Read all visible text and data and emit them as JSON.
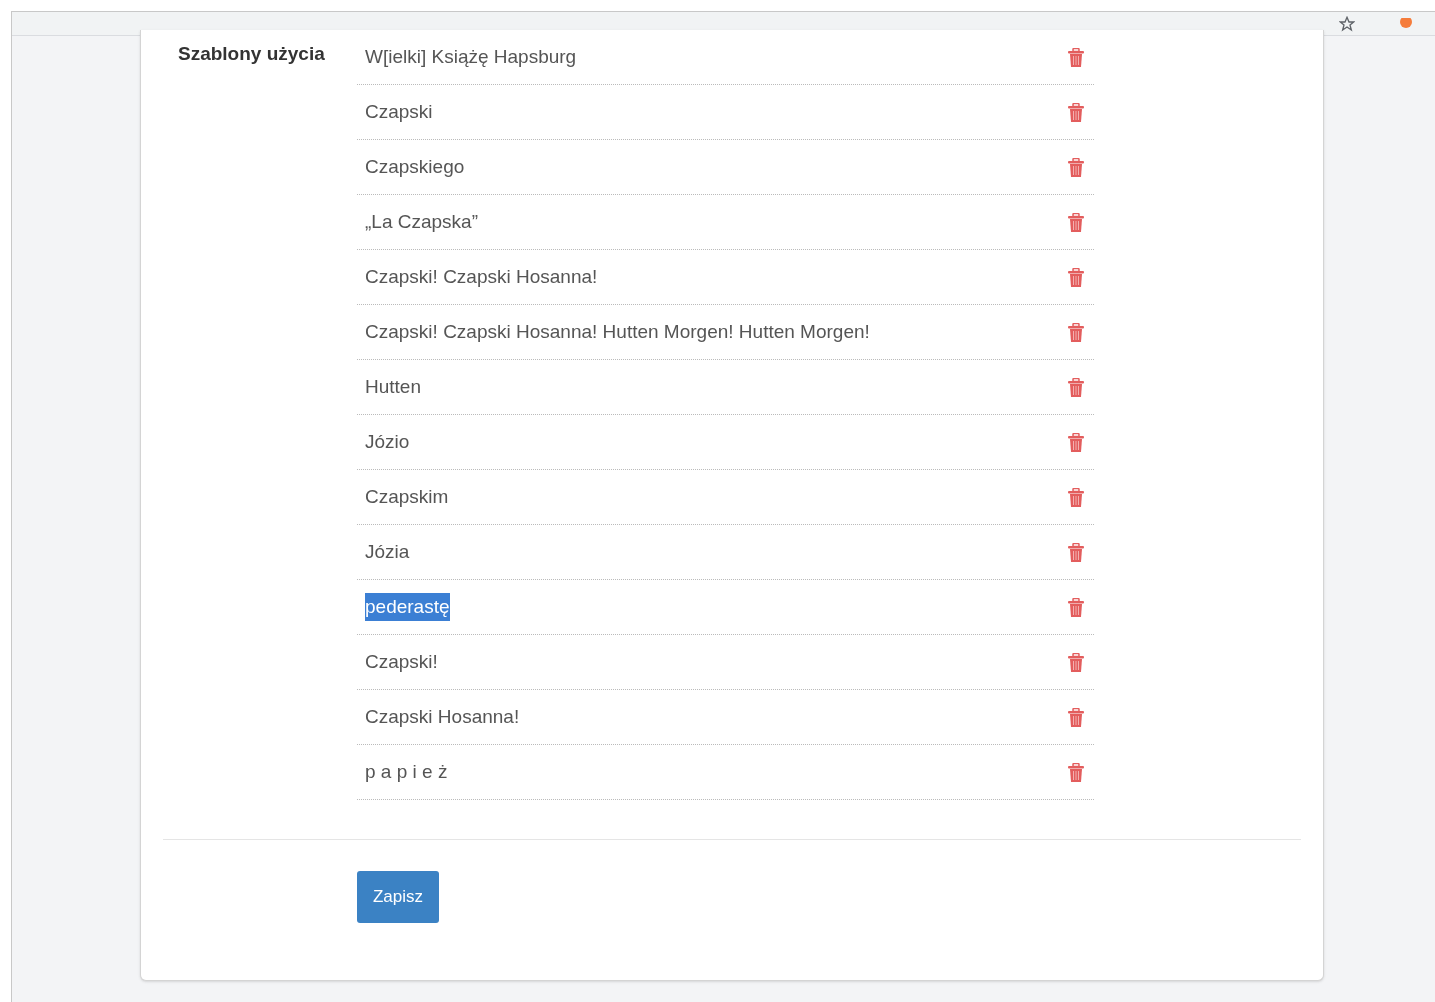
{
  "form": {
    "label": "Szablony użycia",
    "items": [
      {
        "text": "W[ielki] Książę Hapsburg",
        "selected": false
      },
      {
        "text": "Czapski",
        "selected": false
      },
      {
        "text": "Czapskiego",
        "selected": false
      },
      {
        "text": "„La Czapska”",
        "selected": false
      },
      {
        "text": "Czapski! Czapski Hosanna!",
        "selected": false
      },
      {
        "text": "Czapski! Czapski Hosanna! Hutten Morgen! Hutten Morgen!",
        "selected": false
      },
      {
        "text": "Hutten",
        "selected": false
      },
      {
        "text": "Józio",
        "selected": false
      },
      {
        "text": "Czapskim",
        "selected": false
      },
      {
        "text": "Józia",
        "selected": false
      },
      {
        "text": "pederastę",
        "selected": true
      },
      {
        "text": "Czapski!",
        "selected": false
      },
      {
        "text": "Czapski Hosanna!",
        "selected": false
      },
      {
        "text": "p a p i e ż",
        "selected": false
      }
    ],
    "save_button": "Zapisz"
  }
}
